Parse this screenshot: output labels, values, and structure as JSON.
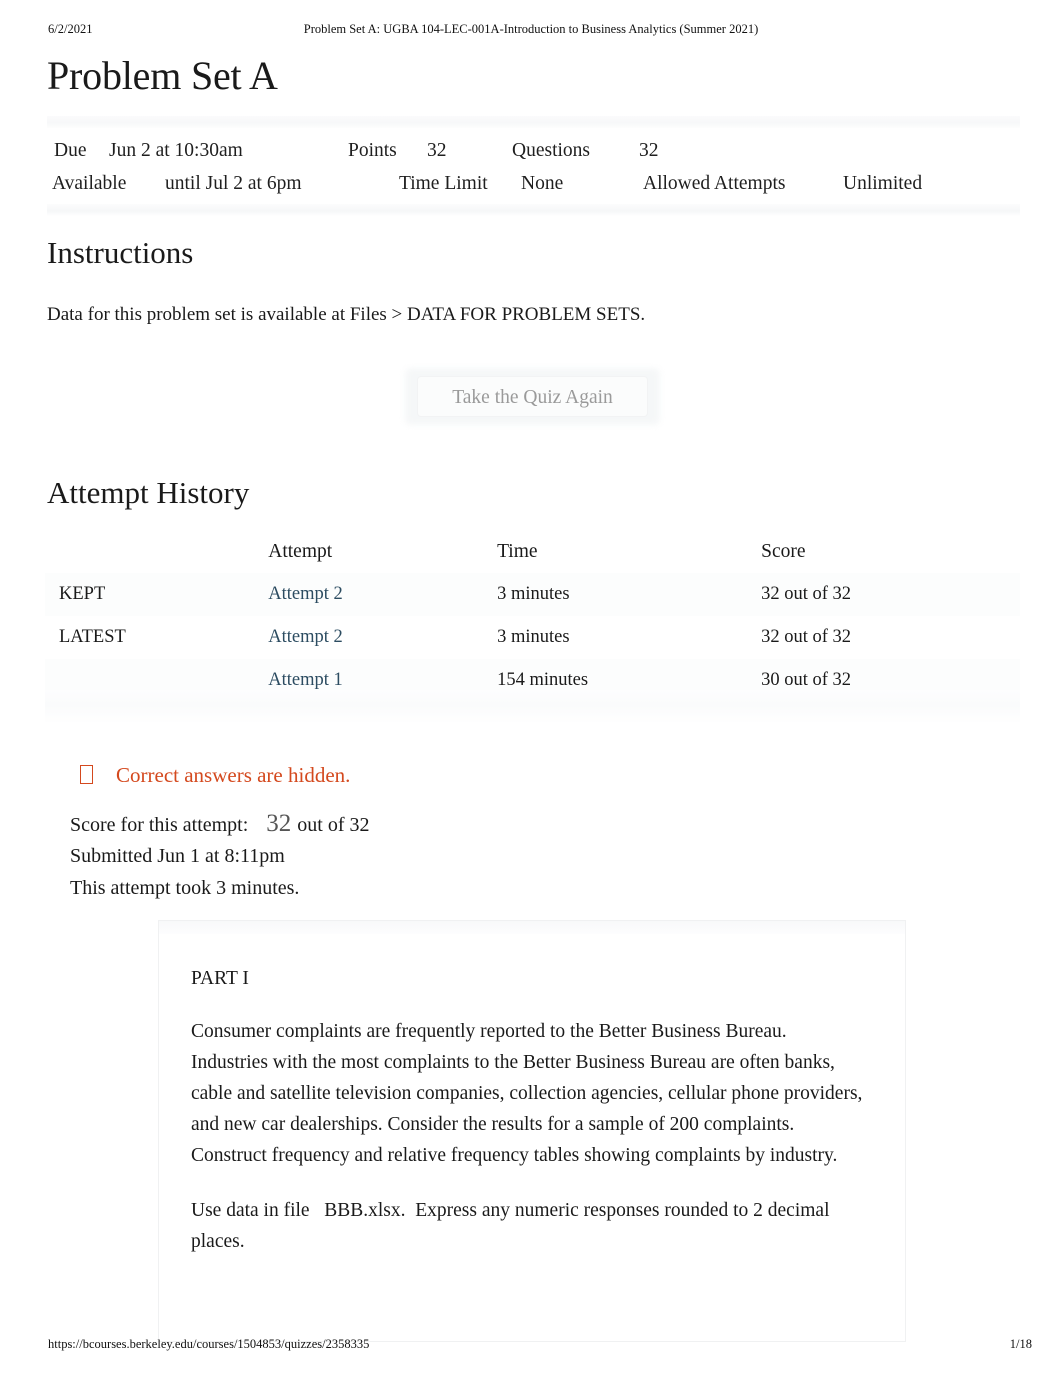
{
  "print": {
    "date": "6/2/2021",
    "doc_title": "Problem Set A: UGBA 104-LEC-001A-Introduction to Business Analytics (Summer 2021)",
    "url": "https://bcourses.berkeley.edu/courses/1504853/quizzes/2358335",
    "page_number": "1/18"
  },
  "quiz": {
    "title": "Problem Set A",
    "meta": {
      "due_label": "Due",
      "due_value": "Jun 2 at 10:30am",
      "points_label": "Points",
      "points_value": "32",
      "questions_label": "Questions",
      "questions_value": "32",
      "available_label": "Available",
      "available_value": "until Jul 2 at 6pm",
      "time_limit_label": "Time Limit",
      "time_limit_value": "None",
      "allowed_attempts_label": "Allowed Attempts",
      "allowed_attempts_value": "Unlimited"
    }
  },
  "instructions": {
    "heading": "Instructions",
    "body": "Data for this problem set is available at Files > DATA FOR PROBLEM SETS."
  },
  "actions": {
    "retake_label": "Take the Quiz Again"
  },
  "attempt_history": {
    "heading": "Attempt History",
    "columns": [
      "",
      "Attempt",
      "Time",
      "Score"
    ],
    "rows": [
      {
        "kind": "KEPT",
        "attempt": "Attempt 2",
        "time": "3 minutes",
        "score": "32 out of 32"
      },
      {
        "kind": "LATEST",
        "attempt": "Attempt 2",
        "time": "3 minutes",
        "score": "32 out of 32"
      },
      {
        "kind": "",
        "attempt": "Attempt 1",
        "time": "154 minutes",
        "score": "30 out of 32"
      }
    ]
  },
  "notice": {
    "icon": "warning-icon",
    "text": "Correct answers are hidden.",
    "color": "#d4491e"
  },
  "result": {
    "score_label": "Score for this attempt:",
    "score_value": "32",
    "score_out_of": "out of 32",
    "submitted": "Submitted Jun 1 at 8:11pm",
    "duration": "This attempt took 3 minutes."
  },
  "question_box": {
    "part_label": "PART I",
    "paragraph_1": "Consumer complaints are frequently reported to the Better Business Bureau.    Industries with the most complaints to the Better Business Bureau are often banks, cable and satellite television companies, collection agencies, cellular phone providers, and new car dealerships. Consider the results for a sample of 200 complaints.          Construct frequency and relative frequency tables showing complaints by industry.",
    "paragraph_2": "Use data in file   BBB.xlsx.  Express any numeric responses rounded to 2 decimal places."
  }
}
